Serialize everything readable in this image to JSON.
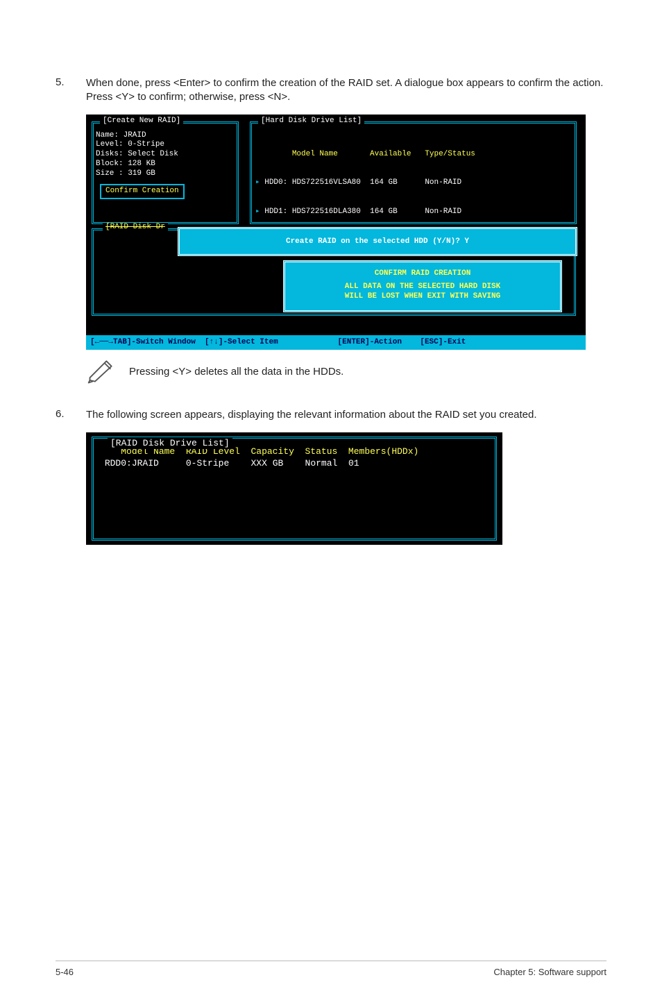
{
  "step5": {
    "num": "5.",
    "text": "When done, press <Enter> to confirm the creation of the RAID set. A dialogue box appears to confirm the action. Press <Y> to confirm; otherwise, press <N>."
  },
  "bios1": {
    "createBoxTitle": "[Create New RAID]",
    "create": {
      "l1": "Name: JRAID",
      "l2": "Level: 0-Stripe",
      "l3": "Disks: Select Disk",
      "l4": "Block: 128 KB",
      "l5": "Size : 319 GB",
      "confirm": "Confirm Creation"
    },
    "hddBoxTitle": "[Hard Disk Drive List]",
    "hddHeader": {
      "model": "Model Name",
      "avail": "Available",
      "type": "Type/Status"
    },
    "hddRows": [
      {
        "dev": "HDD0:",
        "model": "HDS722516VLSA80",
        "size": "164 GB",
        "status": "Non-RAID"
      },
      {
        "dev": "HDD1:",
        "model": "HDS722516DLA380",
        "size": "164 GB",
        "status": "Non-RAID"
      }
    ],
    "raidDiskTitle": "[RAID Disk Dr",
    "popupCreate": "Create RAID on the selected HDD (Y/N)? Y",
    "popupConfirm": {
      "l1": "CONFIRM RAID CREATION",
      "l2": "ALL DATA ON THE SELECTED HARD DISK",
      "l3": "WILL BE LOST WHEN EXIT WITH SAVING"
    },
    "footer": {
      "switch": "TAB]-Switch Window",
      "select": "]-Select Item",
      "action": "[ENTER]-Action",
      "exit": "[ESC]-Exit"
    }
  },
  "note": "Pressing <Y> deletes all the data in the HDDs.",
  "step6": {
    "num": "6.",
    "text": "The following screen appears, displaying the relevant information about the RAID set you created."
  },
  "bios2": {
    "title": "[RAID Disk Drive List]",
    "headers": {
      "model": "Model Name",
      "level": "RAID Level",
      "cap": "Capacity",
      "status": "Status",
      "members": "Members(HDDx)"
    },
    "row": {
      "name": "RDD0:JRAID",
      "level": "0-Stripe",
      "cap": "XXX GB",
      "status": "Normal",
      "members": "01"
    }
  },
  "footer": {
    "left": "5-46",
    "right": "Chapter 5: Software support"
  }
}
